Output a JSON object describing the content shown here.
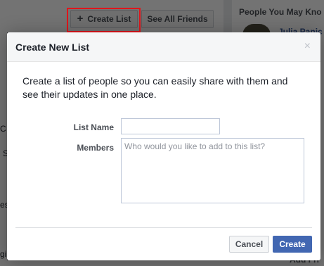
{
  "background": {
    "create_list_button": "Create List",
    "create_list_icon": "+",
    "see_all_friends_button": "See All Friends",
    "people_you_may_know": "People You May Kno",
    "pymk_name": "Julia Panic",
    "add_friend_fragment": "Add Fri",
    "left_fragments": [
      "C",
      "S",
      "es",
      "gi"
    ],
    "right_fragments": [
      "l",
      "l",
      "l",
      "l"
    ]
  },
  "modal": {
    "title": "Create New List",
    "close_icon": "×",
    "description": "Create a list of people so you can easily share with them and see their updates in one place.",
    "list_name_label": "List Name",
    "list_name_value": "",
    "members_label": "Members",
    "members_placeholder": "Who would you like to add to this list?",
    "cancel_button": "Cancel",
    "create_button": "Create"
  },
  "colors": {
    "highlight": "#e0151b",
    "primary": "#4267b2",
    "link": "#365899"
  }
}
